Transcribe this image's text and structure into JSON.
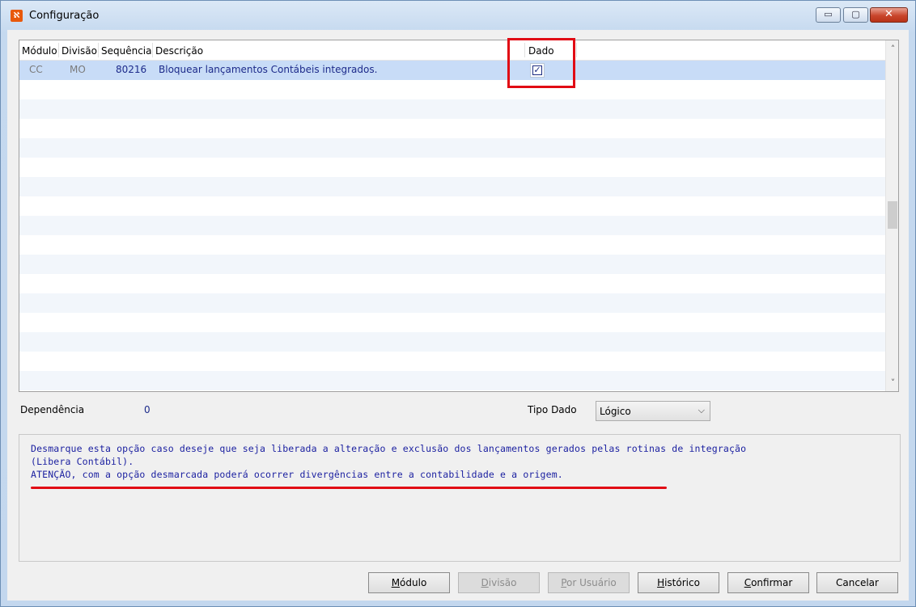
{
  "window": {
    "title": "Configuração",
    "controls": {
      "minimize": "▭",
      "maximize": "▢",
      "close": "✕"
    }
  },
  "grid": {
    "columns": [
      "Módulo",
      "Divisão",
      "Sequência",
      "Descrição",
      "Dado"
    ],
    "rows": [
      {
        "modulo": "CC",
        "divisao": "MO",
        "sequencia": "80216",
        "descricao": "Bloquear lançamentos Contábeis integrados.",
        "dado": true
      }
    ],
    "empty_rows": 16,
    "scrollbar": {
      "up_icon": "chevron-up-icon",
      "down_icon": "chevron-down-icon",
      "up": "˄",
      "down": "˅"
    }
  },
  "fields": {
    "dependencia_label": "Dependência",
    "dependencia_value": "0",
    "tipo_dado_label": "Tipo Dado",
    "tipo_dado_value": "Lógico"
  },
  "memo": {
    "line1": "Desmarque esta opção caso deseje que seja liberada a alteração e exclusão dos lançamentos gerados pelas rotinas de integração",
    "line2": "(Libera Contábil).",
    "line3": "ATENÇÃO, com a opção desmarcada poderá ocorrer divergências entre a contabilidade e a origem."
  },
  "buttons": {
    "modulo": {
      "accel": "M",
      "rest": "ódulo"
    },
    "divisao": {
      "accel": "D",
      "rest": "ivisão"
    },
    "por_usuario": {
      "accel": "P",
      "rest": "or Usuário"
    },
    "historico": {
      "accel": "H",
      "rest": "istórico"
    },
    "confirmar": {
      "accel": "C",
      "rest": "onfirmar"
    },
    "cancelar": {
      "label": "Cancelar"
    }
  },
  "colors": {
    "highlight": "#e10a14",
    "selected_row": "#c8dcf7",
    "text_blue": "#1c2a8a"
  }
}
